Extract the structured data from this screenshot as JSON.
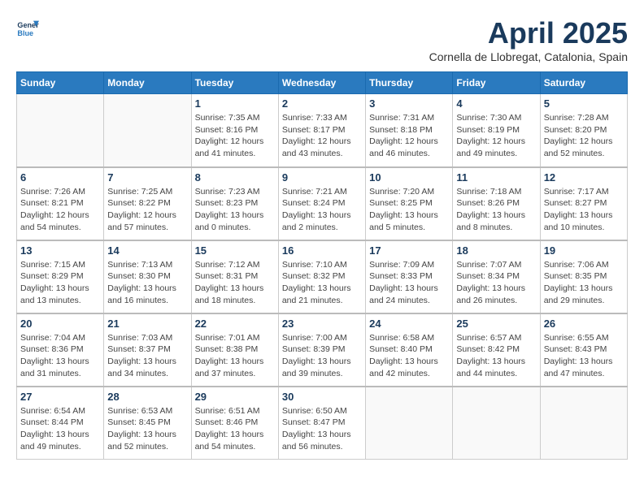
{
  "header": {
    "logo_line1": "General",
    "logo_line2": "Blue",
    "month": "April 2025",
    "location": "Cornella de Llobregat, Catalonia, Spain"
  },
  "columns": [
    "Sunday",
    "Monday",
    "Tuesday",
    "Wednesday",
    "Thursday",
    "Friday",
    "Saturday"
  ],
  "weeks": [
    [
      {
        "day": "",
        "info": ""
      },
      {
        "day": "",
        "info": ""
      },
      {
        "day": "1",
        "info": "Sunrise: 7:35 AM\nSunset: 8:16 PM\nDaylight: 12 hours\nand 41 minutes."
      },
      {
        "day": "2",
        "info": "Sunrise: 7:33 AM\nSunset: 8:17 PM\nDaylight: 12 hours\nand 43 minutes."
      },
      {
        "day": "3",
        "info": "Sunrise: 7:31 AM\nSunset: 8:18 PM\nDaylight: 12 hours\nand 46 minutes."
      },
      {
        "day": "4",
        "info": "Sunrise: 7:30 AM\nSunset: 8:19 PM\nDaylight: 12 hours\nand 49 minutes."
      },
      {
        "day": "5",
        "info": "Sunrise: 7:28 AM\nSunset: 8:20 PM\nDaylight: 12 hours\nand 52 minutes."
      }
    ],
    [
      {
        "day": "6",
        "info": "Sunrise: 7:26 AM\nSunset: 8:21 PM\nDaylight: 12 hours\nand 54 minutes."
      },
      {
        "day": "7",
        "info": "Sunrise: 7:25 AM\nSunset: 8:22 PM\nDaylight: 12 hours\nand 57 minutes."
      },
      {
        "day": "8",
        "info": "Sunrise: 7:23 AM\nSunset: 8:23 PM\nDaylight: 13 hours\nand 0 minutes."
      },
      {
        "day": "9",
        "info": "Sunrise: 7:21 AM\nSunset: 8:24 PM\nDaylight: 13 hours\nand 2 minutes."
      },
      {
        "day": "10",
        "info": "Sunrise: 7:20 AM\nSunset: 8:25 PM\nDaylight: 13 hours\nand 5 minutes."
      },
      {
        "day": "11",
        "info": "Sunrise: 7:18 AM\nSunset: 8:26 PM\nDaylight: 13 hours\nand 8 minutes."
      },
      {
        "day": "12",
        "info": "Sunrise: 7:17 AM\nSunset: 8:27 PM\nDaylight: 13 hours\nand 10 minutes."
      }
    ],
    [
      {
        "day": "13",
        "info": "Sunrise: 7:15 AM\nSunset: 8:29 PM\nDaylight: 13 hours\nand 13 minutes."
      },
      {
        "day": "14",
        "info": "Sunrise: 7:13 AM\nSunset: 8:30 PM\nDaylight: 13 hours\nand 16 minutes."
      },
      {
        "day": "15",
        "info": "Sunrise: 7:12 AM\nSunset: 8:31 PM\nDaylight: 13 hours\nand 18 minutes."
      },
      {
        "day": "16",
        "info": "Sunrise: 7:10 AM\nSunset: 8:32 PM\nDaylight: 13 hours\nand 21 minutes."
      },
      {
        "day": "17",
        "info": "Sunrise: 7:09 AM\nSunset: 8:33 PM\nDaylight: 13 hours\nand 24 minutes."
      },
      {
        "day": "18",
        "info": "Sunrise: 7:07 AM\nSunset: 8:34 PM\nDaylight: 13 hours\nand 26 minutes."
      },
      {
        "day": "19",
        "info": "Sunrise: 7:06 AM\nSunset: 8:35 PM\nDaylight: 13 hours\nand 29 minutes."
      }
    ],
    [
      {
        "day": "20",
        "info": "Sunrise: 7:04 AM\nSunset: 8:36 PM\nDaylight: 13 hours\nand 31 minutes."
      },
      {
        "day": "21",
        "info": "Sunrise: 7:03 AM\nSunset: 8:37 PM\nDaylight: 13 hours\nand 34 minutes."
      },
      {
        "day": "22",
        "info": "Sunrise: 7:01 AM\nSunset: 8:38 PM\nDaylight: 13 hours\nand 37 minutes."
      },
      {
        "day": "23",
        "info": "Sunrise: 7:00 AM\nSunset: 8:39 PM\nDaylight: 13 hours\nand 39 minutes."
      },
      {
        "day": "24",
        "info": "Sunrise: 6:58 AM\nSunset: 8:40 PM\nDaylight: 13 hours\nand 42 minutes."
      },
      {
        "day": "25",
        "info": "Sunrise: 6:57 AM\nSunset: 8:42 PM\nDaylight: 13 hours\nand 44 minutes."
      },
      {
        "day": "26",
        "info": "Sunrise: 6:55 AM\nSunset: 8:43 PM\nDaylight: 13 hours\nand 47 minutes."
      }
    ],
    [
      {
        "day": "27",
        "info": "Sunrise: 6:54 AM\nSunset: 8:44 PM\nDaylight: 13 hours\nand 49 minutes."
      },
      {
        "day": "28",
        "info": "Sunrise: 6:53 AM\nSunset: 8:45 PM\nDaylight: 13 hours\nand 52 minutes."
      },
      {
        "day": "29",
        "info": "Sunrise: 6:51 AM\nSunset: 8:46 PM\nDaylight: 13 hours\nand 54 minutes."
      },
      {
        "day": "30",
        "info": "Sunrise: 6:50 AM\nSunset: 8:47 PM\nDaylight: 13 hours\nand 56 minutes."
      },
      {
        "day": "",
        "info": ""
      },
      {
        "day": "",
        "info": ""
      },
      {
        "day": "",
        "info": ""
      }
    ]
  ]
}
